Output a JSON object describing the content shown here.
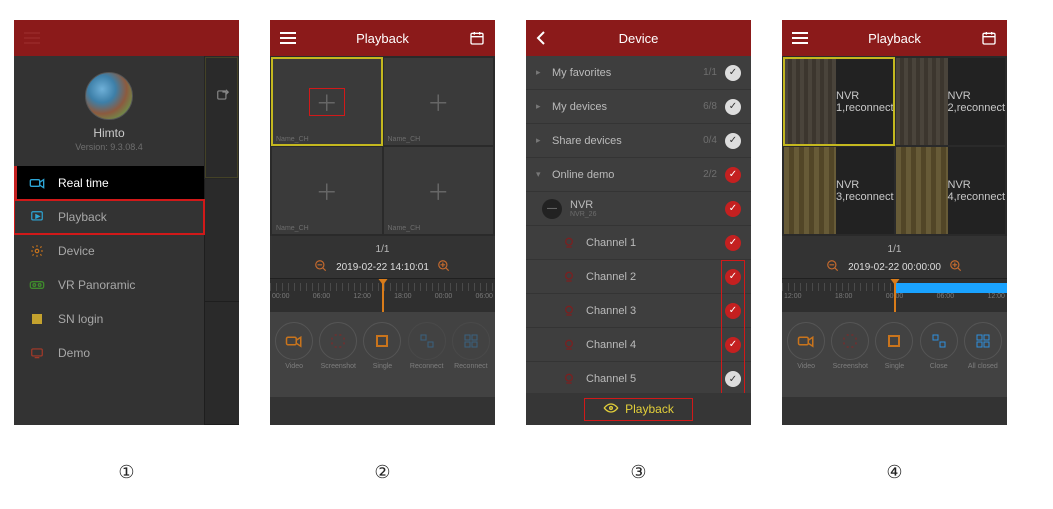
{
  "labels": {
    "p1": "①",
    "p2": "②",
    "p3": "③",
    "p4": "④"
  },
  "p1": {
    "username": "Himto",
    "version": "Version: 9.3.08.4",
    "menu": [
      {
        "label": "Real time"
      },
      {
        "label": "Playback"
      },
      {
        "label": "Device"
      },
      {
        "label": "VR Panoramic"
      },
      {
        "label": "SN login"
      },
      {
        "label": "Demo"
      }
    ]
  },
  "p2": {
    "title": "Playback",
    "tile_label": "Name_CH",
    "page": "1/1",
    "timestamp": "2019-02-22 14:10:01",
    "ruler": [
      "00:00",
      "06:00",
      "12:00",
      "18:00",
      "00:00",
      "06:00"
    ],
    "toolbar": [
      "Video",
      "Screenshot",
      "Single",
      "Reconnect",
      "Reconnect"
    ]
  },
  "p3": {
    "title": "Device",
    "rows": {
      "fav": {
        "label": "My favorites",
        "count": "1/1"
      },
      "my": {
        "label": "My devices",
        "count": "6/8"
      },
      "share": {
        "label": "Share devices",
        "count": "0/4"
      },
      "demo": {
        "label": "Online demo",
        "count": "2/2"
      },
      "nvr": {
        "label": "NVR",
        "sub": "NVR_26"
      }
    },
    "channels": [
      "Channel 1",
      "Channel 2",
      "Channel 3",
      "Channel 4",
      "Channel 5"
    ],
    "playback": "Playback"
  },
  "p4": {
    "title": "Playback",
    "captions": [
      "NVR 1,reconnect",
      "NVR 2,reconnect",
      "NVR 3,reconnect",
      "NVR 4,reconnect"
    ],
    "page": "1/1",
    "timestamp": "2019-02-22 00:00:00",
    "ruler": [
      "12:00",
      "18:00",
      "00:00",
      "06:00",
      "12:00"
    ],
    "toolbar": [
      "Video",
      "Screenshot",
      "Single",
      "Close",
      "All closed"
    ]
  }
}
